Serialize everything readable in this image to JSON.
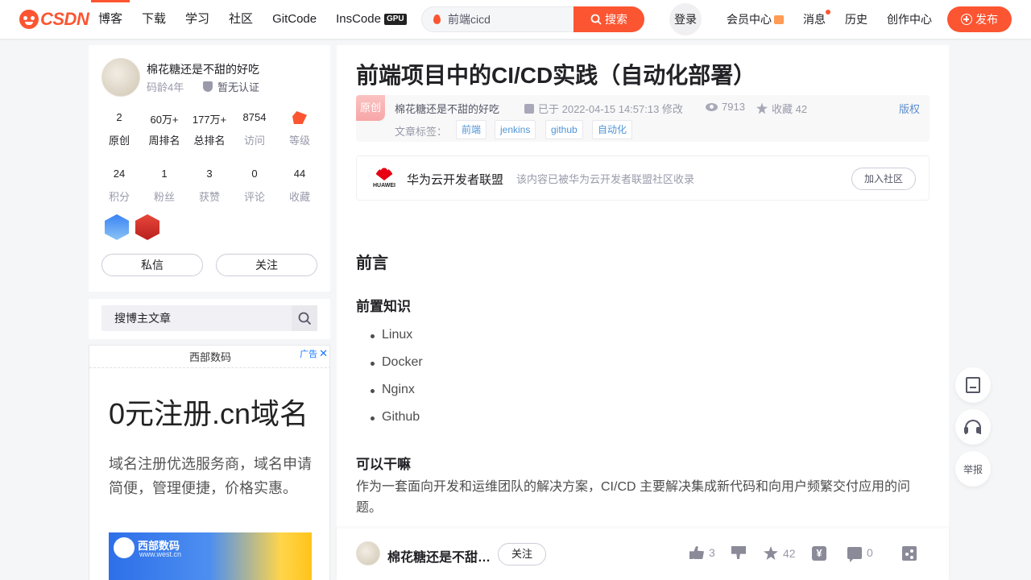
{
  "brand": {
    "logo_text": "CSDN",
    "accent": "#fc5531"
  },
  "nav": {
    "items": [
      {
        "label": "博客",
        "active": true
      },
      {
        "label": "下载"
      },
      {
        "label": "学习"
      },
      {
        "label": "社区"
      },
      {
        "label": "GitCode"
      },
      {
        "label": "InsCode"
      }
    ],
    "gpu_badge": "GPU"
  },
  "search": {
    "placeholder": "前端cicd",
    "button_label": "搜索"
  },
  "header_right": {
    "login": "登录",
    "member": "会员中心",
    "messages": "消息",
    "history": "历史",
    "creator": "创作中心",
    "publish": "发布"
  },
  "profile": {
    "name": "棉花糖还是不甜的好吃",
    "code_age": "码龄4年",
    "certification": "暂无认证",
    "stats_row1": [
      {
        "num": "2",
        "label": "原创"
      },
      {
        "num": "60万+",
        "label": "周排名"
      },
      {
        "num": "177万+",
        "label": "总排名"
      },
      {
        "num": "8754",
        "label": "访问"
      },
      {
        "num": "",
        "label": "等级"
      }
    ],
    "stats_row2": [
      {
        "num": "24",
        "label": "积分"
      },
      {
        "num": "1",
        "label": "粉丝"
      },
      {
        "num": "3",
        "label": "获赞"
      },
      {
        "num": "0",
        "label": "评论"
      },
      {
        "num": "44",
        "label": "收藏"
      }
    ],
    "message_button": "私信",
    "follow_button": "关注"
  },
  "blog_search": {
    "placeholder": "搜博主文章"
  },
  "ad": {
    "brand": "西部数码",
    "tag": "广告",
    "title": "0元注册.cn域名",
    "desc": "域名注册优选服务商，域名申请简便，管理便捷，价格实惠。",
    "banner_name": "西部数码",
    "banner_url": "www.west.cn"
  },
  "article": {
    "title": "前端项目中的CI/CD实践（自动化部署）",
    "original_badge": "原创",
    "author": "棉花糖还是不甜的好吃",
    "time": "已于 2022-04-15 14:57:13 修改",
    "views": "7913",
    "favorites_label": "收藏 42",
    "copyright": "版权",
    "tags_label": "文章标签：",
    "tags": [
      "前端",
      "jenkins",
      "github",
      "自动化"
    ],
    "community": {
      "logo_word": "HUAWEI",
      "name": "华为云开发者联盟",
      "desc": "该内容已被华为云开发者联盟社区收录",
      "join": "加入社区"
    },
    "h_preface": "前言",
    "h_prereq": "前置知识",
    "prereq_items": [
      "Linux",
      "Docker",
      "Nginx",
      "Github"
    ],
    "h_purpose": "可以干嘛",
    "purpose_text": "作为一套面向开发和运维团队的解决方案，CI/CD 主要解决集成新代码和向用户频繁交付应用的问题。"
  },
  "toolbar": {
    "author": "棉花糖还是不甜的好吃",
    "follow": "关注",
    "likes": "3",
    "favorites": "42",
    "comments": "0"
  },
  "float": {
    "report": "举报"
  }
}
